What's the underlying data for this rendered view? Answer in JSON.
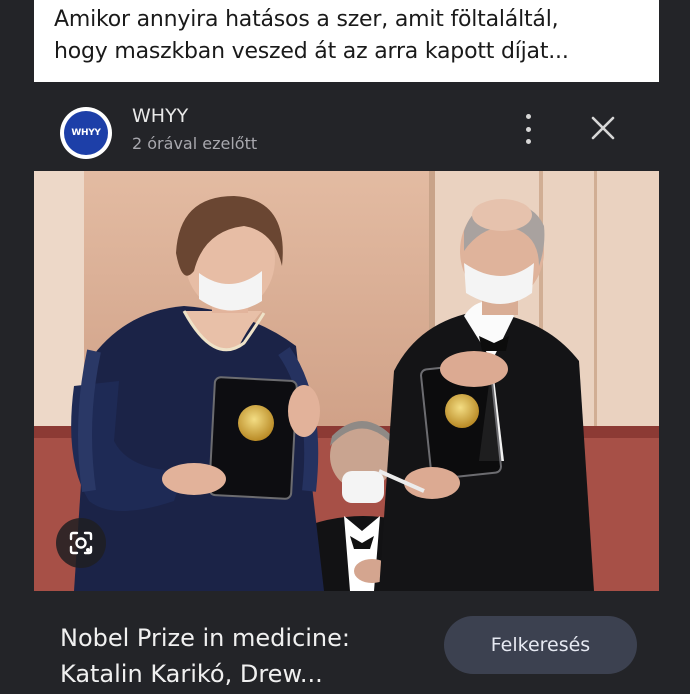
{
  "post": {
    "caption_line1": "Amikor annyira hatásos a szer, amit föltaláltál,",
    "caption_line2": "hogy maszkban veszed át az arra kapott díjat..."
  },
  "card": {
    "logo_text": "WHYY",
    "source_name": "WHYY",
    "time_ago": "2 órával ezelőtt",
    "headline_line1": "Nobel Prize in medicine:",
    "headline_line2": "Katalin Karikó, Drew...",
    "search_button_label": "Felkeresés",
    "icons": [
      "more-vert-icon",
      "close-icon",
      "lens-icon"
    ]
  }
}
